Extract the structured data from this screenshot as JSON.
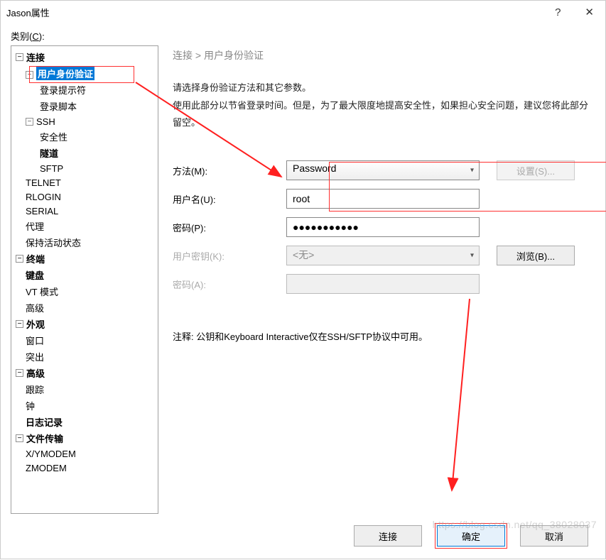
{
  "titlebar": {
    "title": "Jason属性",
    "help": "?",
    "close": "✕"
  },
  "category_label_pre": "类别(",
  "category_label_u": "C",
  "category_label_post": "):",
  "tree": {
    "connection": "连接",
    "user_auth": "用户身份验证",
    "login_prompt": "登录提示符",
    "login_script": "登录脚本",
    "ssh": "SSH",
    "security": "安全性",
    "tunnel": "隧道",
    "sftp": "SFTP",
    "telnet": "TELNET",
    "rlogin": "RLOGIN",
    "serial": "SERIAL",
    "proxy": "代理",
    "keepalive": "保持活动状态",
    "terminal": "终端",
    "keyboard": "键盘",
    "vtmode": "VT 模式",
    "advanced_term": "高级",
    "appearance": "外观",
    "window": "窗口",
    "highlight": "突出",
    "advanced": "高级",
    "trace": "跟踪",
    "clock": "钟",
    "logging": "日志记录",
    "filetransfer": "文件传输",
    "xymodem": "X/YMODEM",
    "zmodem": "ZMODEM"
  },
  "breadcrumb": "连接 > 用户身份验证",
  "desc_line1": "请选择身份验证方法和其它参数。",
  "desc_line2": "使用此部分以节省登录时间。但是，为了最大限度地提高安全性，如果担心安全问题，建议您将此部分留空。",
  "form": {
    "method_label": "方法(M):",
    "method_value": "Password",
    "settings_btn": "设置(S)...",
    "username_label": "用户名(U):",
    "username_value": "root",
    "password_label": "密码(P):",
    "password_value": "●●●●●●●●●●●",
    "userkey_label": "用户密钥(K):",
    "userkey_value": "<无>",
    "browse_btn": "浏览(B)...",
    "passphrase_label": "密码(A):"
  },
  "note": "注释: 公钥和Keyboard Interactive仅在SSH/SFTP协议中可用。",
  "footer": {
    "connect": "连接",
    "ok": "确定",
    "cancel": "取消"
  },
  "watermark": "https://blog.csdn.net/qq_38028037"
}
